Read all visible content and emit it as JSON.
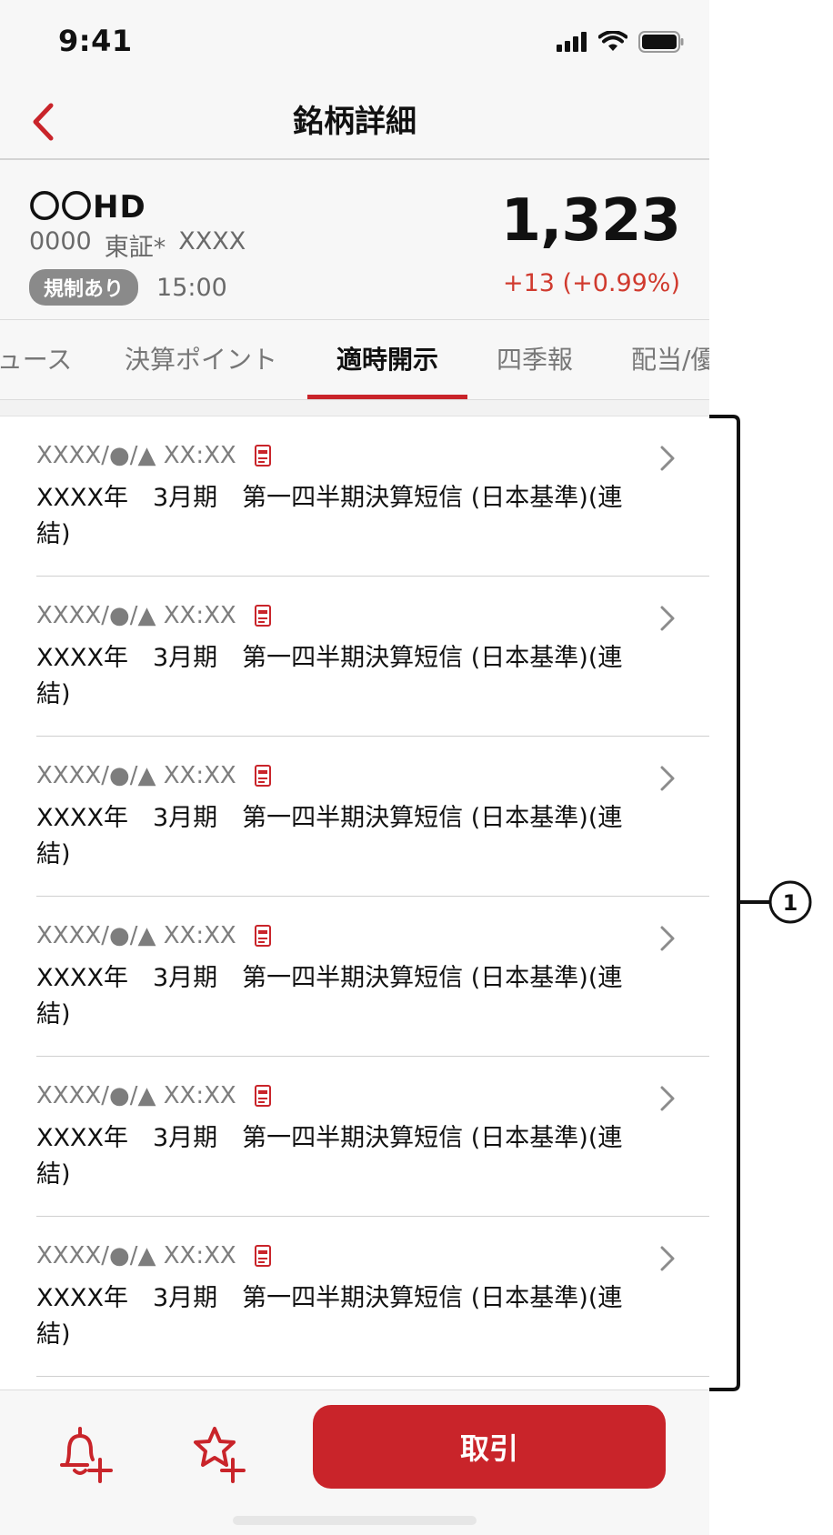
{
  "status_bar": {
    "time": "9:41"
  },
  "nav": {
    "title": "銘柄詳細"
  },
  "stock": {
    "name": "〇〇HD",
    "code": "0000",
    "market": "東証*",
    "extra": "XXXX",
    "badge": "規制あり",
    "time": "15:00",
    "price": "1,323",
    "change": "+13 (+0.99%)"
  },
  "tabs": [
    {
      "label": "ュース"
    },
    {
      "label": "決算ポイント"
    },
    {
      "label": "適時開示"
    },
    {
      "label": "四季報"
    },
    {
      "label": "配当/優"
    }
  ],
  "list": {
    "items": [
      {
        "date": "XXXX/●/▲ XX:XX",
        "title": "XXXX年　3月期　第一四半期決算短信 (日本基準)(連結)"
      },
      {
        "date": "XXXX/●/▲ XX:XX",
        "title": "XXXX年　3月期　第一四半期決算短信 (日本基準)(連結)"
      },
      {
        "date": "XXXX/●/▲ XX:XX",
        "title": "XXXX年　3月期　第一四半期決算短信 (日本基準)(連結)"
      },
      {
        "date": "XXXX/●/▲ XX:XX",
        "title": "XXXX年　3月期　第一四半期決算短信 (日本基準)(連結)"
      },
      {
        "date": "XXXX/●/▲ XX:XX",
        "title": "XXXX年　3月期　第一四半期決算短信 (日本基準)(連結)"
      },
      {
        "date": "XXXX/●/▲ XX:XX",
        "title": "XXXX年　3月期　第一四半期決算短信 (日本基準)(連結)"
      }
    ]
  },
  "bottom_bar": {
    "trade_label": "取引"
  },
  "annotation": {
    "label": "1"
  },
  "colors": {
    "accent": "#c9242a",
    "change": "#d03a2e"
  },
  "icons": {
    "back": "chevron-left-icon",
    "pdf": "pdf-icon",
    "item_arrow": "chevron-right-icon",
    "alert": "bell-plus-icon",
    "favorite": "star-plus-icon"
  }
}
